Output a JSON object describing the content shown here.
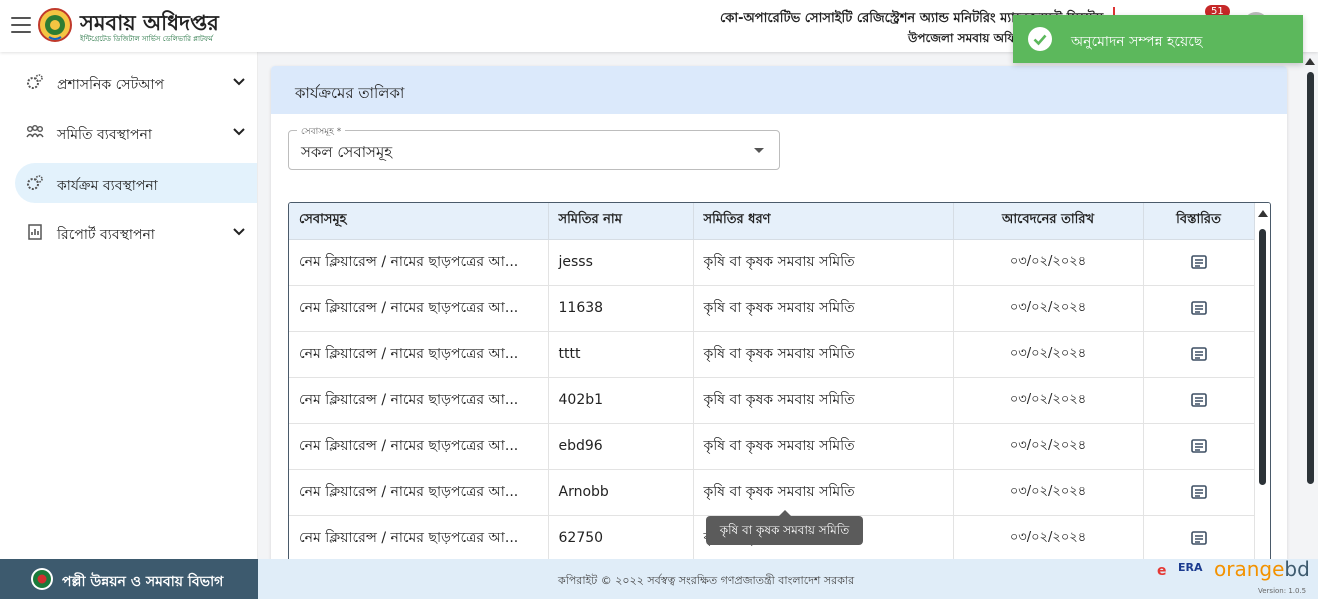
{
  "header": {
    "brand_title": "সমবায় অধিদপ্তর",
    "brand_subtitle": "ইন্টিগ্রেটেড ডিজিটাল সার্ভিস ডেলিভারি প্লাটফর্ম",
    "system_name": "কো-অপারেটিভ সোসাইটি রেজিস্ট্রেশন অ্যান্ড মনিটরিং ম্যানেজমেন্ট সিস্টেম",
    "office_name": "উপজেলা সমবায় অফিস",
    "notification_count": "51"
  },
  "toast": {
    "message": "অনুমোদন সম্পন্ন হয়েছে",
    "color": "#5cb85c"
  },
  "sidebar": {
    "items": [
      {
        "label": "প্রশাসনিক সেটআপ",
        "icon": "gears-icon",
        "expandable": true,
        "active": false
      },
      {
        "label": "সমিতি ব্যবস্থাপনা",
        "icon": "people-icon",
        "expandable": true,
        "active": false
      },
      {
        "label": "কার্যক্রম ব্যবস্থাপনা",
        "icon": "gears-icon",
        "expandable": false,
        "active": true
      },
      {
        "label": "রিপোর্ট ব্যবস্থাপনা",
        "icon": "report-icon",
        "expandable": true,
        "active": false
      }
    ]
  },
  "main": {
    "card_title": "কার্যক্রমের তালিকা",
    "service_select": {
      "label": "সেবাসমূহ *",
      "value": "সকল সেবাসমূহ"
    },
    "table": {
      "columns": [
        "সেবাসমূহ",
        "সমিতির নাম",
        "সমিতির ধরণ",
        "আবেদনের তারিখ",
        "বিস্তারিত"
      ],
      "rows": [
        {
          "service": "নেম ক্লিয়ারেন্স / নামের ছাড়পত্রের আ...",
          "name": "jesss",
          "type": "কৃষি বা কৃষক সমবায় সমিতি",
          "date": "০৩/০২/২০২৪"
        },
        {
          "service": "নেম ক্লিয়ারেন্স / নামের ছাড়পত্রের আ...",
          "name": "11638",
          "type": "কৃষি বা কৃষক সমবায় সমিতি",
          "date": "০৩/০২/২০২৪"
        },
        {
          "service": "নেম ক্লিয়ারেন্স / নামের ছাড়পত্রের আ...",
          "name": "tttt",
          "type": "কৃষি বা কৃষক সমবায় সমিতি",
          "date": "০৩/০২/২০২৪"
        },
        {
          "service": "নেম ক্লিয়ারেন্স / নামের ছাড়পত্রের আ...",
          "name": "402b1",
          "type": "কৃষি বা কৃষক সমবায় সমিতি",
          "date": "০৩/০২/২০২৪"
        },
        {
          "service": "নেম ক্লিয়ারেন্স / নামের ছাড়পত্রের আ...",
          "name": "ebd96",
          "type": "কৃষি বা কৃষক সমবায় সমিতি",
          "date": "০৩/০২/২০২৪"
        },
        {
          "service": "নেম ক্লিয়ারেন্স / নামের ছাড়পত্রের আ...",
          "name": "Arnobb",
          "type": "কৃষি বা কৃষক সমবায় সমিতি",
          "date": "০৩/০২/২০২৪"
        },
        {
          "service": "নেম ক্লিয়ারেন্স / নামের ছাড়পত্রের আ...",
          "name": "62750",
          "type": "কৃষি বা কৃষক সমবায় সমিতি",
          "date": "০৩/০২/২০২৪"
        }
      ]
    },
    "tooltip": "কৃষি বা কৃষক সমবায় সমিতি"
  },
  "footer": {
    "department": "পল্লী উন্নয়ন ও সমবায় বিভাগ",
    "copyright": "কপিরাইট © ২০২২ সর্বস্বত্ব সংরক্ষিত গণপ্রজাতন্ত্রী বাংলাদেশ সরকার",
    "partner_era": "ERA",
    "partner_orange_main": "orange",
    "partner_orange_suffix": "bd",
    "version": "Version: 1.0.5"
  }
}
